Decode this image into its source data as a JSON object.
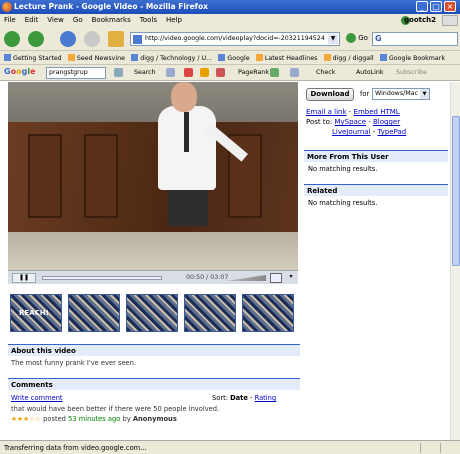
{
  "window": {
    "title": "Lecture Prank - Google Video - Mozilla Firefox",
    "minimize": "_",
    "maximize": "□",
    "close": "×"
  },
  "menu": {
    "items": [
      "File",
      "Edit",
      "View",
      "Go",
      "Bookmarks",
      "Tools",
      "Help"
    ],
    "user": "gootch2"
  },
  "nav": {
    "url": "http://video.google.com/videoplay?docid=-203211945243995",
    "go_label": "Go",
    "search_brand": "G"
  },
  "bookmarks": {
    "items": [
      "Getting Started",
      "Seed Newsvine",
      "digg / Technology / U...",
      "Google",
      "Latest Headlines",
      "digg / diggall",
      "Google Bookmark"
    ]
  },
  "gtoolbar": {
    "logo": "Google",
    "query": "prangstgrup",
    "search_label": "Search",
    "pagerank_label": "PageRank",
    "check_label": "Check",
    "autolink_label": "AutoLink",
    "subscribe_label": "Subscribe"
  },
  "player": {
    "time": "00:50 / 03:07",
    "play_label": "❚❚",
    "menu_label": "▾"
  },
  "about": {
    "heading": "About this video",
    "text": "The most funny prank I've ever seen."
  },
  "comments": {
    "heading": "Comments",
    "write_label": "Write comment",
    "sort_label": "Sort:",
    "sort_date": "Date",
    "sort_sep": " - ",
    "sort_rating": "Rating",
    "items": [
      {
        "text": "that would have been better if there were 50 people involved.",
        "stars": "★★★☆☆",
        "posted_prefix": "posted",
        "posted_time": "53 minutes ago",
        "posted_by_prefix": "by",
        "author": "Anonymous"
      }
    ]
  },
  "sidebar": {
    "download_label": "Download",
    "for_label": "for",
    "os_selected": "Windows/Mac",
    "email_link": "Email a link",
    "embed_link": "Embed HTML",
    "sep": " - ",
    "post_to": "Post to:",
    "post_targets": [
      "MySpace",
      "Blogger",
      "LiveJournal",
      "TypePad"
    ],
    "more_heading": "More From This User",
    "more_text": "No matching results.",
    "related_heading": "Related",
    "related_text": "No matching results."
  },
  "status": {
    "text": "Transferring data from video.google.com..."
  }
}
